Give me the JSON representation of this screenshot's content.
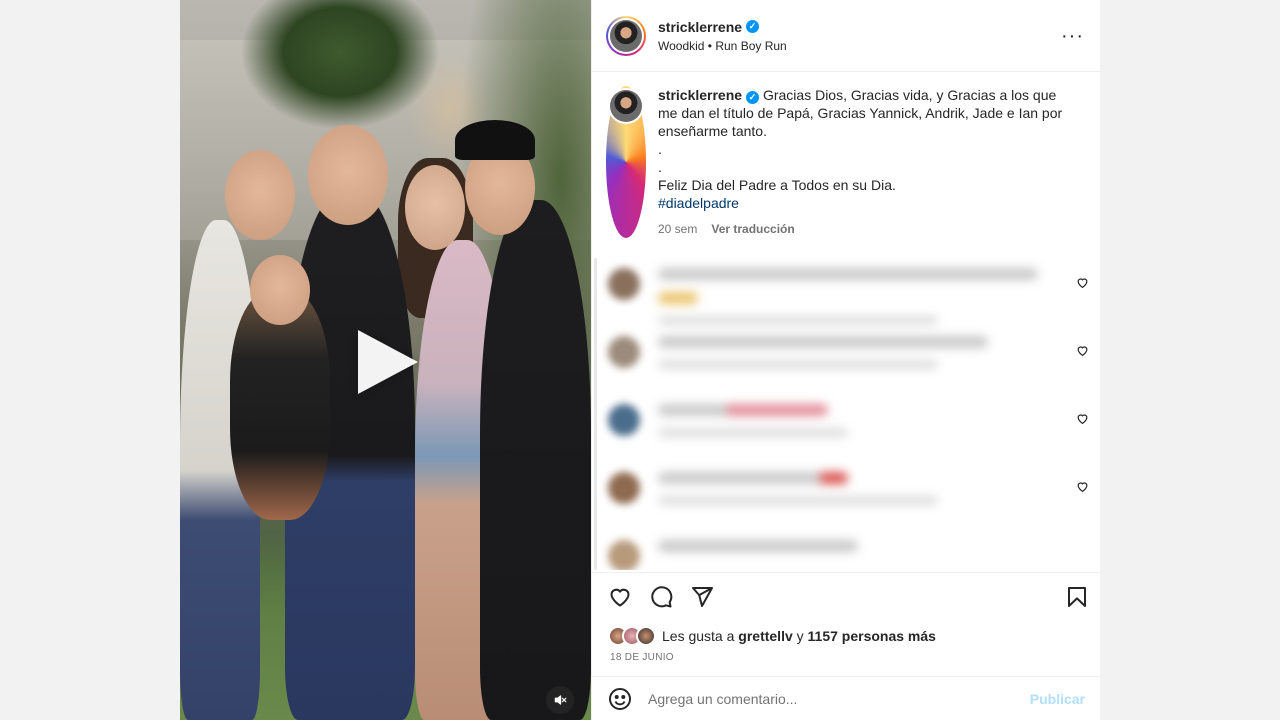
{
  "post": {
    "author": {
      "username": "stricklerrene",
      "verified": true,
      "audio": "Woodkid • Run Boy Run"
    },
    "caption": {
      "text": "Gracias Dios, Gracias vida, y Gracias a los que me dan el título de Papá, Gracias Yannick, Andrik, Jade e Ian por enseñarme tanto.\n.\n.\nFeliz Dia del Padre a Todos en su Dia.",
      "hashtag": "#diadelpadre",
      "age": "20 sem",
      "translate_label": "Ver traducción"
    },
    "media": {
      "type": "video",
      "play_icon": "play-icon",
      "mute_icon": "mute-icon"
    },
    "more_icon": "more-options-icon"
  },
  "comments_count_visible": 5,
  "actions": {
    "like_icon": "heart-icon",
    "comment_icon": "comment-icon",
    "share_icon": "share-icon",
    "save_icon": "bookmark-icon"
  },
  "likes": {
    "prefix": "Les gusta a",
    "user": "grettellv",
    "connector": "y",
    "others": "1157 personas más"
  },
  "date": "18 DE JUNIO",
  "comment_box": {
    "placeholder": "Agrega un comentario...",
    "publish_label": "Publicar",
    "emoji_icon": "emoji-icon"
  },
  "colors": {
    "link": "#00376b",
    "verified": "#0095f6",
    "publish_disabled": "#b2dffc",
    "muted": "#737373"
  }
}
